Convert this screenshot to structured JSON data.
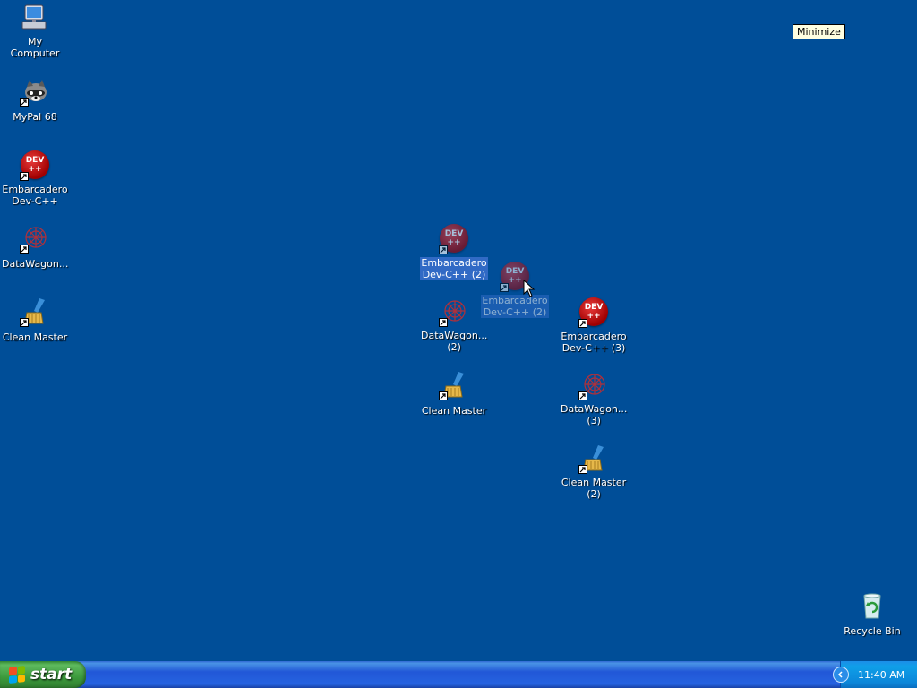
{
  "desktop": {
    "left_column": [
      {
        "label": "My Computer",
        "icon": "my-computer-icon"
      },
      {
        "label": "MyPal 68",
        "icon": "raccoon-icon"
      },
      {
        "label": "Embarcadero\nDev-C++",
        "icon": "devcpp-icon"
      },
      {
        "label": "DataWagon...",
        "icon": "datawagon-icon"
      },
      {
        "label": "Clean Master",
        "icon": "broom-icon"
      }
    ],
    "middle_column": [
      {
        "label": "Embarcadero\nDev-C++ (2)",
        "icon": "devcpp-icon",
        "state": "selected"
      },
      {
        "label": "DataWagon...\n(2)",
        "icon": "datawagon-icon"
      },
      {
        "label": "Clean Master",
        "icon": "broom-icon"
      }
    ],
    "dragging_icon": {
      "label": "Embarcadero\nDev-C++ (2)",
      "icon": "devcpp-icon"
    },
    "right_column": [
      {
        "label": "Embarcadero\nDev-C++ (3)",
        "icon": "devcpp-icon"
      },
      {
        "label": "DataWagon...\n(3)",
        "icon": "datawagon-icon"
      },
      {
        "label": "Clean Master\n(2)",
        "icon": "broom-icon"
      }
    ],
    "recycle_bin": {
      "label": "Recycle Bin",
      "icon": "recycle-bin-icon"
    },
    "dev_badge_text": {
      "line1": "DEV",
      "line2": "++"
    }
  },
  "tooltip": {
    "text": "Minimize"
  },
  "taskbar": {
    "start_label": "start",
    "clock": "11:40 AM",
    "colors": {
      "taskbar": "#2157d7",
      "start": "#3c9a3c",
      "tray": "#0f9fe8"
    }
  }
}
